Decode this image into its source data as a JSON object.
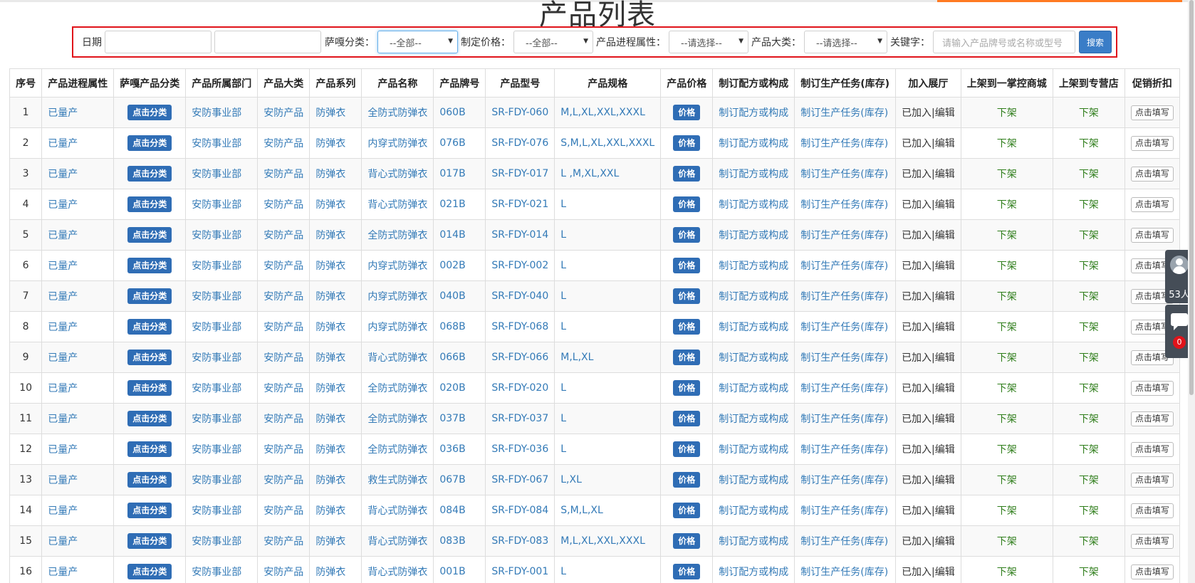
{
  "page": {
    "title": "产品列表"
  },
  "filters": {
    "date_label": "日期",
    "sagai_label": "萨嘎分类：",
    "sagai_value": "--全部--",
    "price_label": "制定价格：",
    "price_value": "--全部--",
    "progress_label": "产品进程属性：",
    "progress_value": "--请选择--",
    "category_label": "产品大类：",
    "category_value": "--请选择--",
    "keyword_label": "关键字：",
    "keyword_placeholder": "请输入产品牌号或名称或型号",
    "search_label": "搜索"
  },
  "table": {
    "headers": [
      "序号",
      "产品进程属性",
      "萨嘎产品分类",
      "产品所属部门",
      "产品大类",
      "产品系列",
      "产品名称",
      "产品牌号",
      "产品型号",
      "产品规格",
      "产品价格",
      "制订配方或构成",
      "制订生产任务(库存)",
      "加入展厅",
      "上架到一掌控商城",
      "上架到专营店",
      "促销折扣"
    ],
    "rows": [
      {
        "no": "1",
        "status": "已量产",
        "classify": "点击分类",
        "dept": "安防事业部",
        "category": "安防产品",
        "series": "防弹衣",
        "name": "全防式防弹衣",
        "brand": "060B",
        "model": "SR-FDY-060",
        "spec": "M,L,XL,XXL,XXXL",
        "price": "价格",
        "formula": "制订配方或构成",
        "task": "制订生产任务(库存)",
        "showroom": "已加入|编辑",
        "mall": "下架",
        "store": "下架",
        "discount": "点击填写"
      },
      {
        "no": "2",
        "status": "已量产",
        "classify": "点击分类",
        "dept": "安防事业部",
        "category": "安防产品",
        "series": "防弹衣",
        "name": "内穿式防弹衣",
        "brand": "076B",
        "model": "SR-FDY-076",
        "spec": "S,M,L,XL,XXL,XXXL",
        "price": "价格",
        "formula": "制订配方或构成",
        "task": "制订生产任务(库存)",
        "showroom": "已加入|编辑",
        "mall": "下架",
        "store": "下架",
        "discount": "点击填写"
      },
      {
        "no": "3",
        "status": "已量产",
        "classify": "点击分类",
        "dept": "安防事业部",
        "category": "安防产品",
        "series": "防弹衣",
        "name": "背心式防弹衣",
        "brand": "017B",
        "model": "SR-FDY-017",
        "spec": "L ,M,XL,XXL",
        "price": "价格",
        "formula": "制订配方或构成",
        "task": "制订生产任务(库存)",
        "showroom": "已加入|编辑",
        "mall": "下架",
        "store": "下架",
        "discount": "点击填写"
      },
      {
        "no": "4",
        "status": "已量产",
        "classify": "点击分类",
        "dept": "安防事业部",
        "category": "安防产品",
        "series": "防弹衣",
        "name": "背心式防弹衣",
        "brand": "021B",
        "model": "SR-FDY-021",
        "spec": "L",
        "price": "价格",
        "formula": "制订配方或构成",
        "task": "制订生产任务(库存)",
        "showroom": "已加入|编辑",
        "mall": "下架",
        "store": "下架",
        "discount": "点击填写"
      },
      {
        "no": "5",
        "status": "已量产",
        "classify": "点击分类",
        "dept": "安防事业部",
        "category": "安防产品",
        "series": "防弹衣",
        "name": "全防式防弹衣",
        "brand": "014B",
        "model": "SR-FDY-014",
        "spec": "L",
        "price": "价格",
        "formula": "制订配方或构成",
        "task": "制订生产任务(库存)",
        "showroom": "已加入|编辑",
        "mall": "下架",
        "store": "下架",
        "discount": "点击填写"
      },
      {
        "no": "6",
        "status": "已量产",
        "classify": "点击分类",
        "dept": "安防事业部",
        "category": "安防产品",
        "series": "防弹衣",
        "name": "内穿式防弹衣",
        "brand": "002B",
        "model": "SR-FDY-002",
        "spec": "L",
        "price": "价格",
        "formula": "制订配方或构成",
        "task": "制订生产任务(库存)",
        "showroom": "已加入|编辑",
        "mall": "下架",
        "store": "下架",
        "discount": "点击填写"
      },
      {
        "no": "7",
        "status": "已量产",
        "classify": "点击分类",
        "dept": "安防事业部",
        "category": "安防产品",
        "series": "防弹衣",
        "name": "内穿式防弹衣",
        "brand": "040B",
        "model": "SR-FDY-040",
        "spec": "L",
        "price": "价格",
        "formula": "制订配方或构成",
        "task": "制订生产任务(库存)",
        "showroom": "已加入|编辑",
        "mall": "下架",
        "store": "下架",
        "discount": "点击填写"
      },
      {
        "no": "8",
        "status": "已量产",
        "classify": "点击分类",
        "dept": "安防事业部",
        "category": "安防产品",
        "series": "防弹衣",
        "name": "内穿式防弹衣",
        "brand": "068B",
        "model": "SR-FDY-068",
        "spec": "L",
        "price": "价格",
        "formula": "制订配方或构成",
        "task": "制订生产任务(库存)",
        "showroom": "已加入|编辑",
        "mall": "下架",
        "store": "下架",
        "discount": "点击填写"
      },
      {
        "no": "9",
        "status": "已量产",
        "classify": "点击分类",
        "dept": "安防事业部",
        "category": "安防产品",
        "series": "防弹衣",
        "name": "背心式防弹衣",
        "brand": "066B",
        "model": "SR-FDY-066",
        "spec": "M,L,XL",
        "price": "价格",
        "formula": "制订配方或构成",
        "task": "制订生产任务(库存)",
        "showroom": "已加入|编辑",
        "mall": "下架",
        "store": "下架",
        "discount": "点击填写"
      },
      {
        "no": "10",
        "status": "已量产",
        "classify": "点击分类",
        "dept": "安防事业部",
        "category": "安防产品",
        "series": "防弹衣",
        "name": "全防式防弹衣",
        "brand": "020B",
        "model": "SR-FDY-020",
        "spec": "L",
        "price": "价格",
        "formula": "制订配方或构成",
        "task": "制订生产任务(库存)",
        "showroom": "已加入|编辑",
        "mall": "下架",
        "store": "下架",
        "discount": "点击填写"
      },
      {
        "no": "11",
        "status": "已量产",
        "classify": "点击分类",
        "dept": "安防事业部",
        "category": "安防产品",
        "series": "防弹衣",
        "name": "全防式防弹衣",
        "brand": "037B",
        "model": "SR-FDY-037",
        "spec": "L",
        "price": "价格",
        "formula": "制订配方或构成",
        "task": "制订生产任务(库存)",
        "showroom": "已加入|编辑",
        "mall": "下架",
        "store": "下架",
        "discount": "点击填写"
      },
      {
        "no": "12",
        "status": "已量产",
        "classify": "点击分类",
        "dept": "安防事业部",
        "category": "安防产品",
        "series": "防弹衣",
        "name": "全防式防弹衣",
        "brand": "036B",
        "model": "SR-FDY-036",
        "spec": "L",
        "price": "价格",
        "formula": "制订配方或构成",
        "task": "制订生产任务(库存)",
        "showroom": "已加入|编辑",
        "mall": "下架",
        "store": "下架",
        "discount": "点击填写"
      },
      {
        "no": "13",
        "status": "已量产",
        "classify": "点击分类",
        "dept": "安防事业部",
        "category": "安防产品",
        "series": "防弹衣",
        "name": "救生式防弹衣",
        "brand": "067B",
        "model": "SR-FDY-067",
        "spec": "L,XL",
        "price": "价格",
        "formula": "制订配方或构成",
        "task": "制订生产任务(库存)",
        "showroom": "已加入|编辑",
        "mall": "下架",
        "store": "下架",
        "discount": "点击填写"
      },
      {
        "no": "14",
        "status": "已量产",
        "classify": "点击分类",
        "dept": "安防事业部",
        "category": "安防产品",
        "series": "防弹衣",
        "name": "背心式防弹衣",
        "brand": "084B",
        "model": "SR-FDY-084",
        "spec": "S,M,L,XL",
        "price": "价格",
        "formula": "制订配方或构成",
        "task": "制订生产任务(库存)",
        "showroom": "已加入|编辑",
        "mall": "下架",
        "store": "下架",
        "discount": "点击填写"
      },
      {
        "no": "15",
        "status": "已量产",
        "classify": "点击分类",
        "dept": "安防事业部",
        "category": "安防产品",
        "series": "防弹衣",
        "name": "背心式防弹衣",
        "brand": "083B",
        "model": "SR-FDY-083",
        "spec": "M,L,XL,XXL,XXXL",
        "price": "价格",
        "formula": "制订配方或构成",
        "task": "制订生产任务(库存)",
        "showroom": "已加入|编辑",
        "mall": "下架",
        "store": "下架",
        "discount": "点击填写"
      },
      {
        "no": "16",
        "status": "已量产",
        "classify": "点击分类",
        "dept": "安防事业部",
        "category": "安防产品",
        "series": "防弹衣",
        "name": "背心式防弹衣",
        "brand": "001B",
        "model": "SR-FDY-001",
        "spec": "L",
        "price": "价格",
        "formula": "制订配方或构成",
        "task": "制订生产任务(库存)",
        "showroom": "已加入|编辑",
        "mall": "下架",
        "store": "下架",
        "discount": "点击填写"
      }
    ]
  },
  "side_widget": {
    "online_count": "53人",
    "message_count": "0"
  },
  "colors": {
    "link": "#337ab7",
    "badge": "#2f6db5",
    "green_text": "#2e7d1a",
    "highlight_border": "#e0131a"
  }
}
